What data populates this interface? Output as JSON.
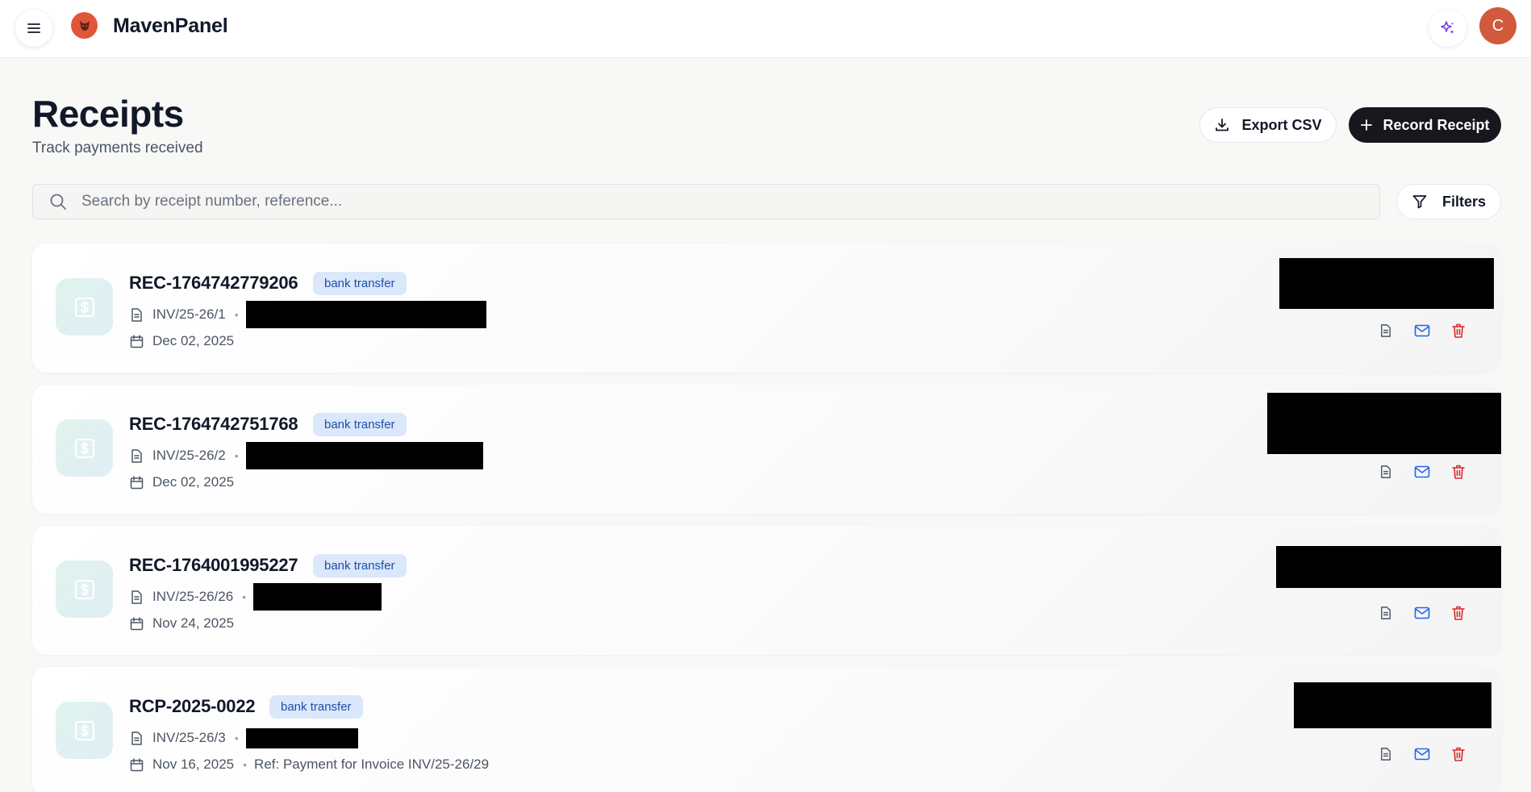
{
  "app": {
    "name": "MavenPanel",
    "avatar_initial": "C"
  },
  "page": {
    "title": "Receipts",
    "subtitle": "Track payments received"
  },
  "toolbar": {
    "export_label": "Export CSV",
    "record_label": "Record Receipt",
    "filters_label": "Filters"
  },
  "search": {
    "placeholder": "Search by receipt number, reference...",
    "value": ""
  },
  "colors": {
    "brand_logo": "#e2553a",
    "avatar": "#d05a3b",
    "primary_button": "#16181d",
    "badge_bg": "#dbe7fb",
    "badge_text": "#1e4ea8",
    "mail_icon": "#2563eb",
    "trash_icon": "#dc2626",
    "sparkle_icon": "#7c3aed"
  },
  "icons": {
    "menu": "menu-icon",
    "logo": "fox-logo-icon",
    "sparkle": "sparkle-icon",
    "download": "download-icon",
    "plus": "plus-icon",
    "search": "search-icon",
    "filter": "filter-icon",
    "receipt": "dollar-receipt-icon",
    "invoice": "document-icon",
    "date": "calendar-icon",
    "view_pdf": "document-icon",
    "email": "mail-icon",
    "delete": "trash-icon"
  },
  "receipts": [
    {
      "number": "REC-1764742779206",
      "method": "bank transfer",
      "invoice": "INV/25-26/1",
      "customer": "",
      "date": "Dec 02, 2025",
      "reference": ""
    },
    {
      "number": "REC-1764742751768",
      "method": "bank transfer",
      "invoice": "INV/25-26/2",
      "customer": "",
      "date": "Dec 02, 2025",
      "reference": ""
    },
    {
      "number": "REC-1764001995227",
      "method": "bank transfer",
      "invoice": "INV/25-26/26",
      "customer": "",
      "date": "Nov 24, 2025",
      "reference": ""
    },
    {
      "number": "RCP-2025-0022",
      "method": "bank transfer",
      "invoice": "INV/25-26/3",
      "customer": "",
      "date": "Nov 16, 2025",
      "reference": "Ref: Payment for Invoice INV/25-26/29"
    }
  ]
}
